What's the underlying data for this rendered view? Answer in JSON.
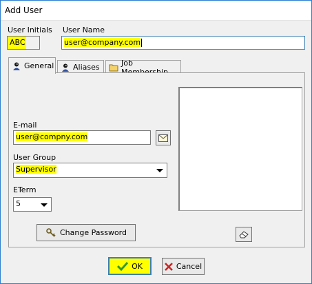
{
  "window": {
    "title": "Add User"
  },
  "header": {
    "initials_label": "User Initials",
    "initials_value": "ABC",
    "username_label": "User Name",
    "username_value": "user@company.com"
  },
  "tabs": [
    {
      "label": "General",
      "icon": "user-icon",
      "active": true
    },
    {
      "label": "Aliases",
      "icon": "user-icon",
      "active": false
    },
    {
      "label": "Job Membership",
      "icon": "folder-icon",
      "active": false
    }
  ],
  "general": {
    "email_label": "E-mail",
    "email_value": "user@compny.com",
    "group_label": "User Group",
    "group_value": "Supervisor",
    "eterm_label": "ETerm",
    "eterm_value": "5",
    "change_password_label": "Change Password"
  },
  "footer": {
    "ok_label": "OK",
    "cancel_label": "Cancel"
  },
  "colors": {
    "highlight": "#ffff00",
    "window_border": "#2b7fd0",
    "ok_check": "#2e9b2e",
    "cancel_x": "#c62828"
  }
}
